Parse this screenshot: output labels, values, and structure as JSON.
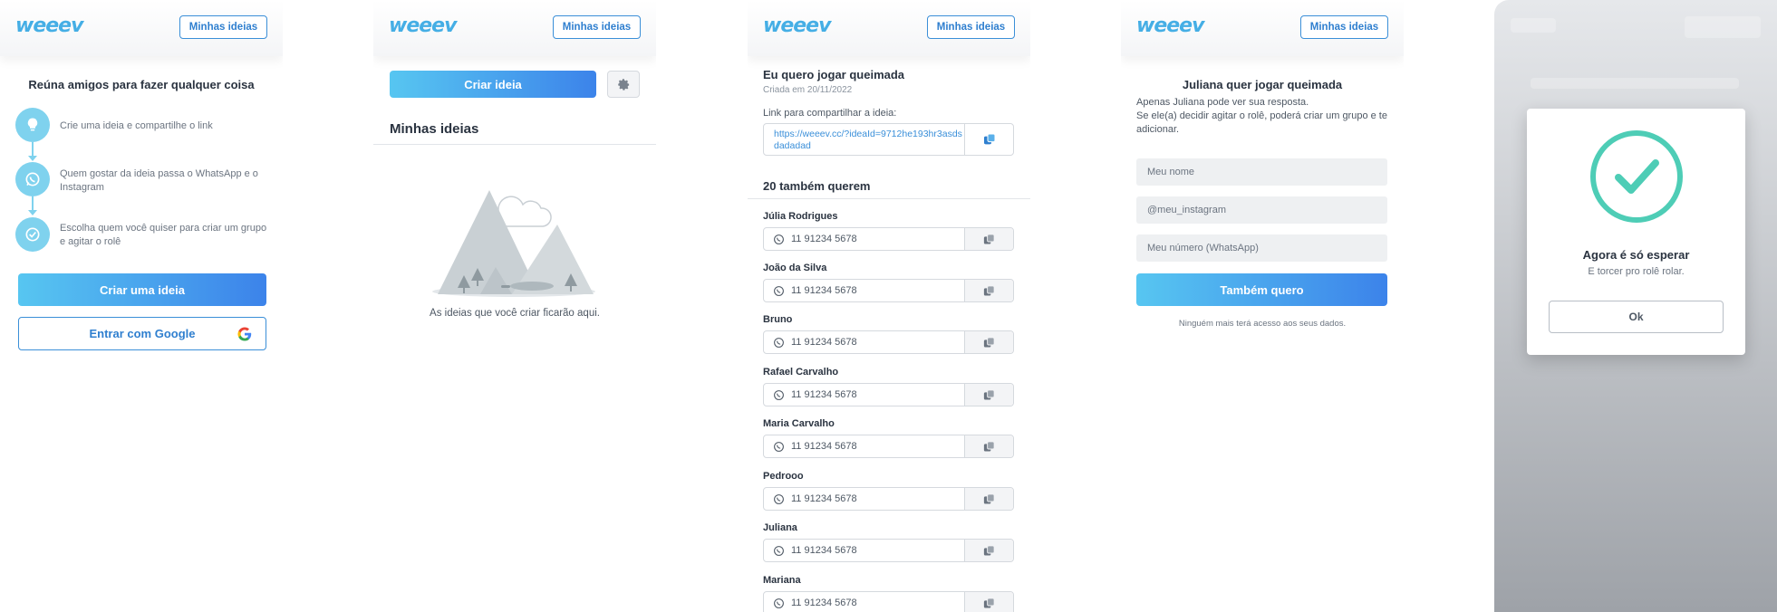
{
  "brand": {
    "logo": "weeev",
    "accent": "#45aee5",
    "gradient_start": "#57c6f1",
    "gradient_end": "#3c83ea"
  },
  "header": {
    "my_ideas_label": "Minhas ideias"
  },
  "screen1": {
    "title": "Reúna amigos para fazer qualquer coisa",
    "steps": [
      {
        "icon": "lightbulb-icon",
        "text": "Crie uma ideia e compartilhe o link"
      },
      {
        "icon": "whatsapp-icon",
        "text": "Quem gostar da ideia passa o WhatsApp e o Instagram"
      },
      {
        "icon": "check-circle-icon",
        "text": "Escolha quem você quiser para criar um grupo e agitar o rolê"
      }
    ],
    "create_button": "Criar uma ideia",
    "google_button": "Entrar com Google"
  },
  "screen2": {
    "create_button": "Criar ideia",
    "section_title": "Minhas ideias",
    "empty_text": "As ideias que você criar ficarão aqui."
  },
  "screen3": {
    "idea_title": "Eu quero jogar queimada",
    "created_date": "Criada em 20/11/2022",
    "share_label": "Link para compartilhar a ideia:",
    "share_link": "https://weeev.cc/?ideaId=9712he193hr3asdsdadadad",
    "count_title": "20 também querem",
    "people": [
      {
        "name": "Júlia Rodrigues",
        "phone": "11 91234 5678"
      },
      {
        "name": "João da Silva",
        "phone": "11 91234 5678"
      },
      {
        "name": "Bruno",
        "phone": "11 91234 5678"
      },
      {
        "name": "Rafael Carvalho",
        "phone": "11 91234 5678"
      },
      {
        "name": "Maria Carvalho",
        "phone": "11 91234 5678"
      },
      {
        "name": "Pedrooo",
        "phone": "11 91234 5678"
      },
      {
        "name": "Juliana",
        "phone": "11 91234 5678"
      },
      {
        "name": "Mariana",
        "phone": "11 91234 5678"
      }
    ]
  },
  "screen4": {
    "title": "Juliana quer jogar queimada",
    "description_1": "Apenas Juliana pode ver sua resposta.",
    "description_2": "Se ele(a) decidir agitar o rolê, poderá criar um grupo e te adicionar.",
    "name_placeholder": "Meu nome",
    "instagram_placeholder": "@meu_instagram",
    "phone_placeholder": "Meu número (WhatsApp)",
    "submit_button": "Também quero",
    "privacy_note": "Ninguém mais terá acesso aos seus dados."
  },
  "screen5": {
    "modal_title": "Agora é só esperar",
    "modal_subtitle": "E torcer pro rolê rolar.",
    "ok_button": "Ok",
    "success_color": "#4ecdb6"
  }
}
